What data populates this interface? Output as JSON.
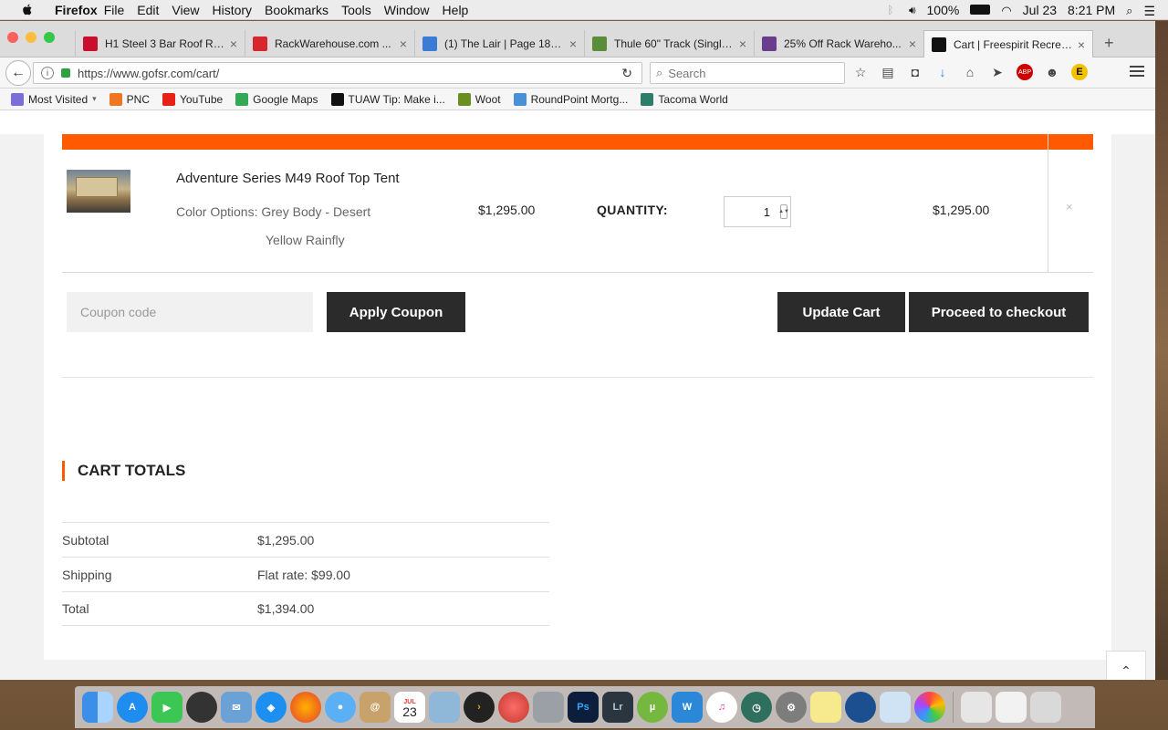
{
  "menubar": {
    "app_name": "Firefox",
    "menus": [
      "File",
      "Edit",
      "View",
      "History",
      "Bookmarks",
      "Tools",
      "Window",
      "Help"
    ],
    "battery": "100%",
    "date": "Jul 23",
    "time": "8:21 PM"
  },
  "tabs": [
    {
      "title": "H1 Steel 3 Bar Roof Ra...",
      "icon_color": "#c8102e"
    },
    {
      "title": "RackWarehouse.com ...",
      "icon_color": "#d7262c"
    },
    {
      "title": "(1) The Lair | Page 180 |...",
      "icon_color": "#3a7bd5"
    },
    {
      "title": "Thule 60\" Track (Single...",
      "icon_color": "#5b8c3a"
    },
    {
      "title": "25% Off Rack Wareho...",
      "icon_color": "#6a3d8f"
    },
    {
      "title": "Cart | Freespirit Recrea...",
      "icon_color": "#111111",
      "active": true
    }
  ],
  "navbar": {
    "url": "https://www.gofsr.com/cart/",
    "search_placeholder": "Search"
  },
  "bookmarks": [
    {
      "label": "Most Visited",
      "icon_color": "#7a6fd6"
    },
    {
      "label": "PNC",
      "icon_color": "#ef7622"
    },
    {
      "label": "YouTube",
      "icon_color": "#e62117"
    },
    {
      "label": "Google Maps",
      "icon_color": "#34a853"
    },
    {
      "label": "TUAW Tip: Make i...",
      "icon_color": "#111111"
    },
    {
      "label": "Woot",
      "icon_color": "#6b8e23"
    },
    {
      "label": "RoundPoint Mortg...",
      "icon_color": "#4a90d9"
    },
    {
      "label": "Tacoma World",
      "icon_color": "#2e7d6b"
    }
  ],
  "cart": {
    "product_name": "Adventure Series M49 Roof Top Tent",
    "variant_line1": "Color Options: Grey Body - Desert",
    "variant_line2": "Yellow Rainfly",
    "price": "$1,295.00",
    "quantity_label": "QUANTITY:",
    "quantity": "1",
    "line_subtotal": "$1,295.00",
    "remove_glyph": "×"
  },
  "actions": {
    "coupon_placeholder": "Coupon code",
    "apply_coupon": "Apply Coupon",
    "update_cart": "Update Cart",
    "proceed_checkout": "Proceed to checkout"
  },
  "totals": {
    "heading": "CART TOTALS",
    "rows": [
      {
        "label": "Subtotal",
        "value": "$1,295.00"
      },
      {
        "label": "Shipping",
        "value": "Flat rate: $99.00"
      },
      {
        "label": "Total",
        "value": "$1,394.00"
      }
    ]
  },
  "colors": {
    "accent": "#ff5a00",
    "button_dark": "#2b2b2b"
  },
  "dock_calendar": {
    "month": "JUL",
    "day": "23"
  }
}
